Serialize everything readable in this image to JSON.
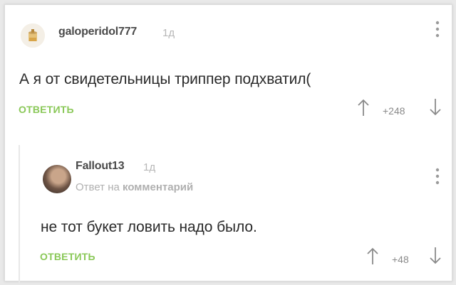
{
  "comments": [
    {
      "username": "galoperidol777",
      "time": "1д",
      "text": "А я от свидетельницы триппер подхватил(",
      "reply_label": "ОТВЕТИТЬ",
      "rating": "+248"
    },
    {
      "username": "Fallout13",
      "time": "1д",
      "reply_prefix": "Ответ на",
      "reply_target": "комментарий",
      "text": "не тот букет ловить надо было.",
      "reply_label": "ОТВЕТИТЬ",
      "rating": "+48"
    }
  ],
  "colors": {
    "accent": "#8ac858",
    "username": "#4a4a4a",
    "muted": "#b7b7b7",
    "text": "#2a2a2a"
  },
  "icons": [
    "avatar",
    "menu-dots-icon",
    "arrow-up-icon",
    "arrow-down-icon"
  ]
}
